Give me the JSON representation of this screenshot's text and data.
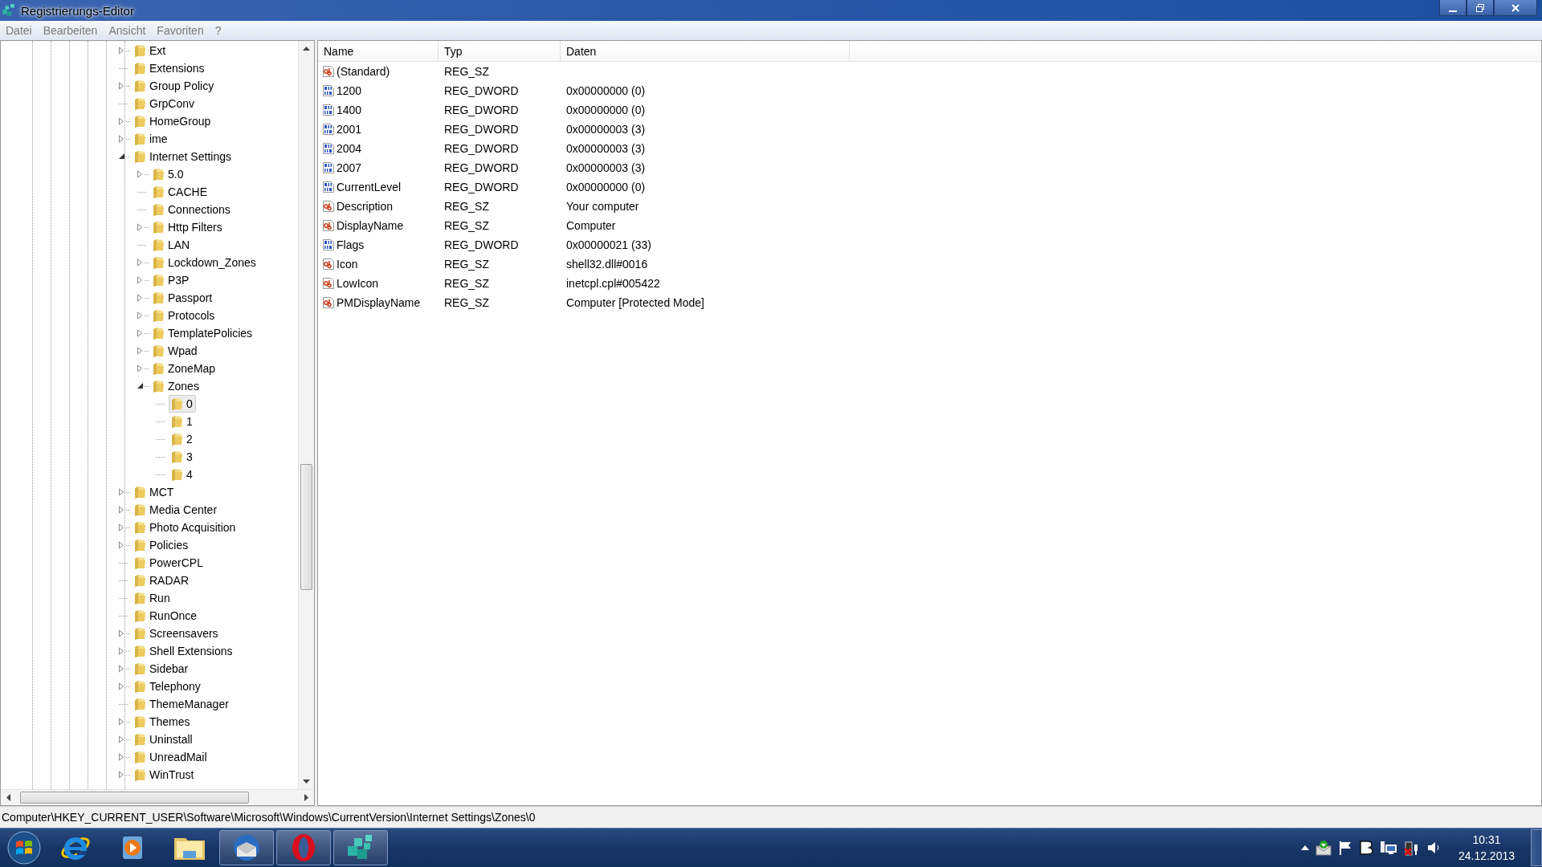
{
  "window": {
    "title": "Registrierungs-Editor"
  },
  "menu": [
    "Datei",
    "Bearbeiten",
    "Ansicht",
    "Favoriten",
    "?"
  ],
  "tree": {
    "items": [
      {
        "label": "Ext",
        "expandable": true,
        "expanded": false,
        "selected": false
      },
      {
        "label": "Extensions",
        "expandable": false,
        "selected": false
      },
      {
        "label": "Group Policy",
        "expandable": true,
        "expanded": false,
        "selected": false
      },
      {
        "label": "GrpConv",
        "expandable": false,
        "selected": false
      },
      {
        "label": "HomeGroup",
        "expandable": true,
        "expanded": false,
        "selected": false
      },
      {
        "label": "ime",
        "expandable": true,
        "expanded": false,
        "selected": false
      },
      {
        "label": "Internet Settings",
        "expandable": true,
        "expanded": true,
        "selected": false,
        "children": [
          {
            "label": "5.0",
            "expandable": true,
            "expanded": false,
            "selected": false
          },
          {
            "label": "CACHE",
            "expandable": false,
            "selected": false
          },
          {
            "label": "Connections",
            "expandable": false,
            "selected": false
          },
          {
            "label": "Http Filters",
            "expandable": true,
            "expanded": false,
            "selected": false
          },
          {
            "label": "LAN",
            "expandable": false,
            "selected": false
          },
          {
            "label": "Lockdown_Zones",
            "expandable": true,
            "expanded": false,
            "selected": false
          },
          {
            "label": "P3P",
            "expandable": true,
            "expanded": false,
            "selected": false
          },
          {
            "label": "Passport",
            "expandable": true,
            "expanded": false,
            "selected": false
          },
          {
            "label": "Protocols",
            "expandable": true,
            "expanded": false,
            "selected": false
          },
          {
            "label": "TemplatePolicies",
            "expandable": true,
            "expanded": false,
            "selected": false
          },
          {
            "label": "Wpad",
            "expandable": true,
            "expanded": false,
            "selected": false
          },
          {
            "label": "ZoneMap",
            "expandable": true,
            "expanded": false,
            "selected": false
          },
          {
            "label": "Zones",
            "expandable": true,
            "expanded": true,
            "selected": false,
            "children": [
              {
                "label": "0",
                "expandable": false,
                "selected": true
              },
              {
                "label": "1",
                "expandable": false,
                "selected": false
              },
              {
                "label": "2",
                "expandable": false,
                "selected": false
              },
              {
                "label": "3",
                "expandable": false,
                "selected": false
              },
              {
                "label": "4",
                "expandable": false,
                "selected": false
              }
            ]
          }
        ]
      },
      {
        "label": "MCT",
        "expandable": true,
        "expanded": false,
        "selected": false
      },
      {
        "label": "Media Center",
        "expandable": true,
        "expanded": false,
        "selected": false
      },
      {
        "label": "Photo Acquisition",
        "expandable": true,
        "expanded": false,
        "selected": false
      },
      {
        "label": "Policies",
        "expandable": true,
        "expanded": false,
        "selected": false
      },
      {
        "label": "PowerCPL",
        "expandable": false,
        "selected": false
      },
      {
        "label": "RADAR",
        "expandable": false,
        "selected": false
      },
      {
        "label": "Run",
        "expandable": false,
        "selected": false
      },
      {
        "label": "RunOnce",
        "expandable": false,
        "selected": false
      },
      {
        "label": "Screensavers",
        "expandable": true,
        "expanded": false,
        "selected": false
      },
      {
        "label": "Shell Extensions",
        "expandable": true,
        "expanded": false,
        "selected": false
      },
      {
        "label": "Sidebar",
        "expandable": true,
        "expanded": false,
        "selected": false
      },
      {
        "label": "Telephony",
        "expandable": true,
        "expanded": false,
        "selected": false
      },
      {
        "label": "ThemeManager",
        "expandable": false,
        "selected": false
      },
      {
        "label": "Themes",
        "expandable": true,
        "expanded": false,
        "selected": false
      },
      {
        "label": "Uninstall",
        "expandable": true,
        "expanded": false,
        "selected": false
      },
      {
        "label": "UnreadMail",
        "expandable": true,
        "expanded": false,
        "selected": false
      },
      {
        "label": "WinTrust",
        "expandable": true,
        "expanded": false,
        "selected": false
      }
    ]
  },
  "values": {
    "columns": [
      "Name",
      "Typ",
      "Daten"
    ],
    "rows": [
      {
        "kind": "sz",
        "name": "(Standard)",
        "type": "REG_SZ"
      },
      {
        "kind": "dword",
        "name": "1200",
        "type": "REG_DWORD",
        "data": "0x00000000 (0)"
      },
      {
        "kind": "dword",
        "name": "1400",
        "type": "REG_DWORD",
        "data": "0x00000000 (0)"
      },
      {
        "kind": "dword",
        "name": "2001",
        "type": "REG_DWORD",
        "data": "0x00000003 (3)"
      },
      {
        "kind": "dword",
        "name": "2004",
        "type": "REG_DWORD",
        "data": "0x00000003 (3)"
      },
      {
        "kind": "dword",
        "name": "2007",
        "type": "REG_DWORD",
        "data": "0x00000003 (3)"
      },
      {
        "kind": "dword",
        "name": "CurrentLevel",
        "type": "REG_DWORD",
        "data": "0x00000000 (0)"
      },
      {
        "kind": "sz",
        "name": "Description",
        "type": "REG_SZ",
        "data": "Your computer"
      },
      {
        "kind": "sz",
        "name": "DisplayName",
        "type": "REG_SZ",
        "data": "Computer"
      },
      {
        "kind": "dword",
        "name": "Flags",
        "type": "REG_DWORD",
        "data": "0x00000021 (33)"
      },
      {
        "kind": "sz",
        "name": "Icon",
        "type": "REG_SZ",
        "data": "shell32.dll#0016"
      },
      {
        "kind": "sz",
        "name": "LowIcon",
        "type": "REG_SZ",
        "data": "inetcpl.cpl#005422"
      },
      {
        "kind": "sz",
        "name": "PMDisplayName",
        "type": "REG_SZ",
        "data": "Computer [Protected Mode]"
      }
    ]
  },
  "status_bar": "Computer\\HKEY_CURRENT_USER\\Software\\Microsoft\\Windows\\CurrentVersion\\Internet Settings\\Zones\\0",
  "taskbar": {
    "apps": [
      {
        "kind": "ie",
        "running": false
      },
      {
        "kind": "media",
        "running": false
      },
      {
        "kind": "explorer",
        "running": false
      },
      {
        "kind": "mail",
        "running": true
      },
      {
        "kind": "opera",
        "running": true
      },
      {
        "kind": "regedit",
        "running": true
      }
    ],
    "clock": {
      "time": "10:31",
      "date": "24.12.2013"
    }
  }
}
